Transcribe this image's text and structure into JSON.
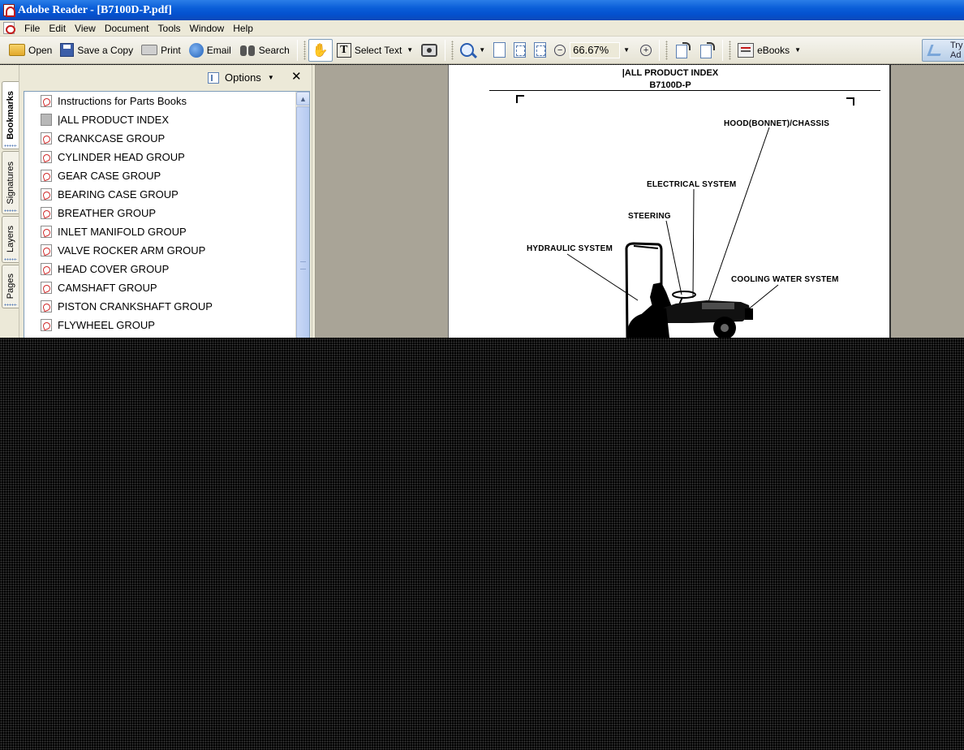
{
  "window": {
    "title": "Adobe Reader - [B7100D-P.pdf]"
  },
  "menubar": {
    "items": [
      "File",
      "Edit",
      "View",
      "Document",
      "Tools",
      "Window",
      "Help"
    ]
  },
  "toolbar": {
    "open_label": "Open",
    "save_copy_label": "Save a Copy",
    "print_label": "Print",
    "email_label": "Email",
    "search_label": "Search",
    "select_text_label": "Select Text",
    "zoom_value": "66.67%",
    "ebooks_label": "eBooks",
    "try_label_line1": "Try",
    "try_label_line2": "Ad"
  },
  "nav_tabs": [
    "Bookmarks",
    "Signatures",
    "Layers",
    "Pages"
  ],
  "bookmarks_pane": {
    "options_label": "Options",
    "close_glyph": "✕",
    "items": [
      "Instructions for Parts Books",
      "|ALL PRODUCT INDEX",
      "CRANKCASE GROUP",
      "CYLINDER HEAD GROUP",
      "GEAR CASE GROUP",
      "BEARING CASE GROUP",
      "BREATHER GROUP",
      "INLET MANIFOLD GROUP",
      "VALVE ROCKER ARM GROUP",
      "HEAD COVER GROUP",
      "CAMSHAFT GROUP",
      "PISTON CRANKSHAFT GROUP",
      "FLYWHEEL GROUP"
    ]
  },
  "document": {
    "title_line1": "|ALL PRODUCT INDEX",
    "title_line2": "B7100D-P",
    "callouts": {
      "hood": "HOOD(BONNET)/CHASSIS",
      "electrical": "ELECTRICAL SYSTEM",
      "steering": "STEERING",
      "hydraulic": "HYDRAULIC SYSTEM",
      "cooling": "COOLING WATER SYSTEM"
    }
  },
  "icons": {
    "open": "folder-open-icon",
    "save": "floppy-disk-icon",
    "print": "printer-icon",
    "email": "email-globe-icon",
    "search": "binoculars-icon",
    "hand": "hand-tool-icon",
    "snapshot": "camera-icon",
    "zoom_in": "magnifier-icon",
    "bookmark": "pdf-page-icon"
  }
}
